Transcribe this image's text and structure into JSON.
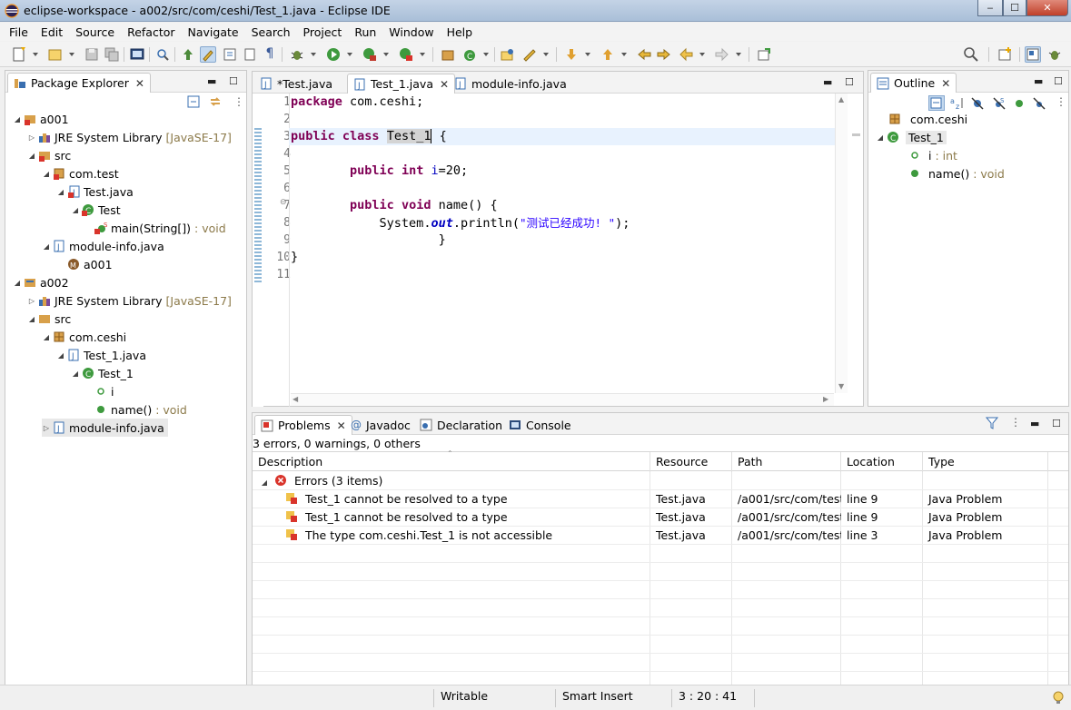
{
  "window": {
    "title": "eclipse-workspace - a002/src/com/ceshi/Test_1.java - Eclipse IDE"
  },
  "menu": [
    "File",
    "Edit",
    "Source",
    "Refactor",
    "Navigate",
    "Search",
    "Project",
    "Run",
    "Window",
    "Help"
  ],
  "package_explorer": {
    "title": "Package Explorer",
    "tree": [
      {
        "label": "a001",
        "decoration": ""
      },
      {
        "label": "JRE System Library",
        "decoration": "[JavaSE-17]"
      },
      {
        "label": "src",
        "decoration": ""
      },
      {
        "label": "com.test",
        "decoration": ""
      },
      {
        "label": "Test.java",
        "decoration": ""
      },
      {
        "label": "Test",
        "decoration": ""
      },
      {
        "label": "main(String[])",
        "decoration": ": void"
      },
      {
        "label": "module-info.java",
        "decoration": ""
      },
      {
        "label": "a001",
        "decoration": ""
      },
      {
        "label": "a002",
        "decoration": ""
      },
      {
        "label": "JRE System Library",
        "decoration": "[JavaSE-17]"
      },
      {
        "label": "src",
        "decoration": ""
      },
      {
        "label": "com.ceshi",
        "decoration": ""
      },
      {
        "label": "Test_1.java",
        "decoration": ""
      },
      {
        "label": "Test_1",
        "decoration": ""
      },
      {
        "label": "i",
        "decoration": ""
      },
      {
        "label": "name()",
        "decoration": ": void"
      },
      {
        "label": "module-info.java",
        "decoration": ""
      }
    ]
  },
  "editor": {
    "tabs": [
      {
        "label": "*Test.java"
      },
      {
        "label": "Test_1.java"
      },
      {
        "label": "module-info.java"
      }
    ],
    "line_numbers": [
      "1",
      "2",
      "3",
      "4",
      "5",
      "6",
      "7",
      "8",
      "9",
      "10",
      "11"
    ],
    "code": {
      "l1_kw": "package",
      "l1_rest": " com.ceshi;",
      "l3_kw1": "public",
      "l3_kw2": "class",
      "l3_sel": "Test_1",
      "l3_rest": " {",
      "l5_kw1": "public",
      "l5_kw2": "int",
      "l5_fld": "i",
      "l5_rest": "=20;",
      "l7_kw1": "public",
      "l7_kw2": "void",
      "l7_rest": " name() {",
      "l8_a": "System.",
      "l8_out": "out",
      "l8_b": ".println(",
      "l8_str": "\"测试已经成功! \"",
      "l8_c": ");",
      "l9": "}",
      "l10": "}"
    }
  },
  "outline": {
    "title": "Outline",
    "tree": [
      {
        "label": "com.ceshi",
        "decoration": ""
      },
      {
        "label": "Test_1",
        "decoration": ""
      },
      {
        "label": "i",
        "decoration": ": int"
      },
      {
        "label": "name()",
        "decoration": ": void"
      }
    ]
  },
  "bottom": {
    "tabs": [
      {
        "label": "Problems"
      },
      {
        "label": "Javadoc"
      },
      {
        "label": "Declaration"
      },
      {
        "label": "Console"
      }
    ],
    "summary": "3 errors, 0 warnings, 0 others",
    "columns": [
      "Description",
      "Resource",
      "Path",
      "Location",
      "Type"
    ],
    "group": "Errors (3 items)",
    "rows": [
      {
        "description": "Test_1 cannot be resolved to a type",
        "resource": "Test.java",
        "path": "/a001/src/com/test",
        "location": "line 9",
        "type": "Java Problem"
      },
      {
        "description": "Test_1 cannot be resolved to a type",
        "resource": "Test.java",
        "path": "/a001/src/com/test",
        "location": "line 9",
        "type": "Java Problem"
      },
      {
        "description": "The type com.ceshi.Test_1 is not accessible",
        "resource": "Test.java",
        "path": "/a001/src/com/test",
        "location": "line 3",
        "type": "Java Problem"
      }
    ]
  },
  "statusbar": {
    "writable": "Writable",
    "insert_mode": "Smart Insert",
    "position": "3 : 20 : 41"
  },
  "colors": {
    "keyword": "#7f0055",
    "field": "#0000c0",
    "string": "#2a00ff",
    "error": "#d9342b",
    "accent": "#3a7bd5"
  }
}
